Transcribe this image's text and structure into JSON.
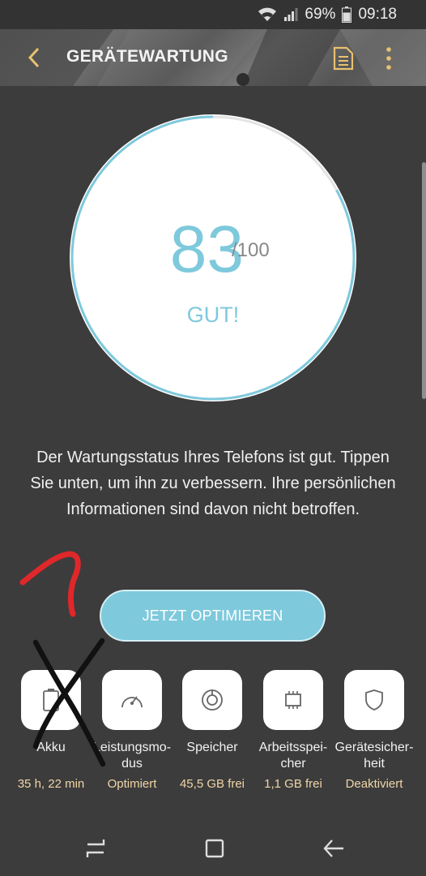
{
  "status_bar": {
    "battery_percent": "69%",
    "time": "09:18",
    "icons": [
      "wifi-icon",
      "signal-icon",
      "battery-icon"
    ]
  },
  "app_bar": {
    "title": "GERÄTEWARTUNG",
    "icons": [
      "back-arrow-icon",
      "report-icon",
      "more-vert-icon"
    ]
  },
  "score": {
    "value": "83",
    "max": "/100",
    "label": "GUT!",
    "progress": 0.83
  },
  "message": "Der Wartungsstatus Ihres Telefons ist gut. Tippen Sie unten, um ihn zu verbessern. Ihre persönlichen Informationen sind davon nicht betroffen.",
  "optimize_button": "JETZT OPTIMIEREN",
  "tiles": [
    {
      "name": "Akku",
      "value": "35 h, 22 min",
      "icon": "battery-icon"
    },
    {
      "name": "Leistungsmo-\ndus",
      "value": "Optimiert",
      "icon": "gauge-icon"
    },
    {
      "name": "Speicher",
      "value": "45,5 GB frei",
      "icon": "storage-icon"
    },
    {
      "name": "Arbeitsspei-\ncher",
      "value": "1,1 GB frei",
      "icon": "memory-chip-icon"
    },
    {
      "name": "Gerätesicher-\nheit",
      "value": "Deaktiviert",
      "icon": "shield-icon"
    }
  ],
  "colors": {
    "accent": "#7ec9dc",
    "background": "#3c3c3c",
    "value_text": "#f0d6a8",
    "annotation_red": "#e0272a",
    "annotation_black": "#111111"
  },
  "nav_bar": {
    "icons": [
      "recent-apps-icon",
      "home-icon",
      "back-icon"
    ]
  }
}
